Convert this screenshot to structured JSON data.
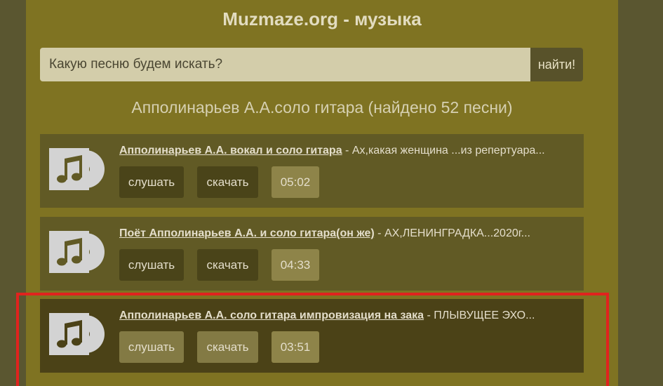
{
  "header": {
    "title": "Muzmaze.org - музыка"
  },
  "search": {
    "placeholder": "Какую песню будем искать?",
    "button_label": "найти!"
  },
  "results": {
    "heading": "Апполинарьев А.А.соло гитара (найдено 52 песни)"
  },
  "tracks": [
    {
      "name": "Апполинарьев А.А. вокал и соло гитара",
      "description": " - Ах,какая женщина ...из репертуара...",
      "listen_label": "слушать",
      "download_label": "скачать",
      "duration": "05:02"
    },
    {
      "name": "Поёт Апполинарьев А.А. и соло гитара(он же)",
      "description": " - АХ,ЛЕНИНГРАДКА...2020г...",
      "listen_label": "слушать",
      "download_label": "скачать",
      "duration": "04:33"
    },
    {
      "name": "Апполинарьев А.А. соло гитара импровизация на зака",
      "description": " - ПЛЫВУЩЕЕ ЭХО...",
      "listen_label": "слушать",
      "download_label": "скачать",
      "duration": "03:51"
    }
  ],
  "icons": {
    "track_cover": "music-disc-icon"
  },
  "colors": {
    "highlight_border": "#e0231e"
  }
}
